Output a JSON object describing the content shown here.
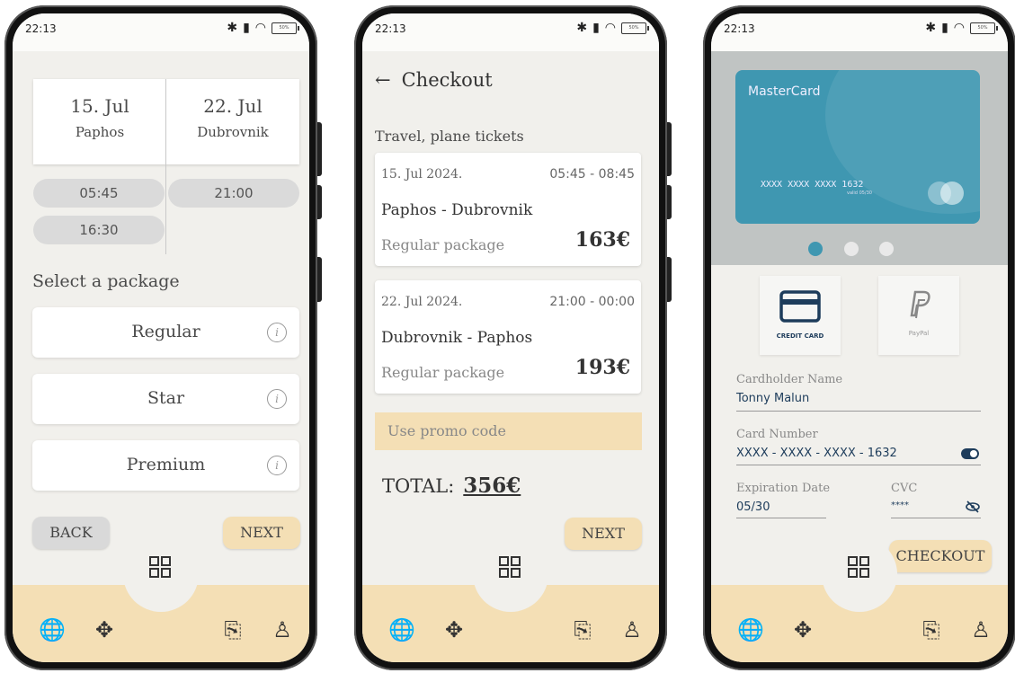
{
  "status": {
    "time": "22:13",
    "battery": "50%"
  },
  "screen1": {
    "outbound": {
      "date": "15. Jul",
      "city": "Paphos"
    },
    "inbound": {
      "date": "22. Jul",
      "city": "Dubrovnik"
    },
    "outbound_times": [
      "05:45",
      "16:30"
    ],
    "inbound_times": [
      "21:00"
    ],
    "section_label": "Select a package",
    "packages": [
      "Regular",
      "Star",
      "Premium"
    ],
    "info_glyph": "i",
    "back_label": "BACK",
    "next_label": "NEXT"
  },
  "screen2": {
    "back_arrow": "←",
    "title": "Checkout",
    "section_label": "Travel, plane tickets",
    "tickets": [
      {
        "date": "15. Jul 2024.",
        "time": "05:45 - 08:45",
        "route": "Paphos - Dubrovnik",
        "package": "Regular package",
        "price": "163€"
      },
      {
        "date": "22. Jul 2024.",
        "time": "21:00 - 00:00",
        "route": "Dubrovnik - Paphos",
        "package": "Regular package",
        "price": "193€"
      }
    ],
    "promo_placeholder": "Use promo code",
    "total_label": "TOTAL:",
    "total_value": "356€",
    "next_label": "NEXT"
  },
  "screen3": {
    "card": {
      "brand": "MasterCard",
      "number": "XXXX XXXX XXXX 1632",
      "expiry": "valid 05/30"
    },
    "carousel": {
      "count": 3,
      "active": 0
    },
    "payment_options": [
      "CREDIT CARD",
      "PayPal"
    ],
    "cardholder": {
      "label": "Cardholder Name",
      "value": "Tonny Malun"
    },
    "card_number": {
      "label": "Card Number",
      "value": "XXXX - XXXX - XXXX - 1632"
    },
    "expiration": {
      "label": "Expiration Date",
      "value": "05/30"
    },
    "cvc": {
      "label": "CVC",
      "value": "****"
    },
    "checkout_label": "CHECKOUT"
  },
  "nav": {
    "icons": [
      "globe-plane-icon",
      "move-icon",
      "ticket-icon",
      "user-icon"
    ],
    "center_icon": "grid-icon"
  },
  "colors": {
    "accent": "#f4dfb5",
    "card": "#3f97b1",
    "background": "#f1f0ec",
    "active_dot": "#3f97b1"
  }
}
